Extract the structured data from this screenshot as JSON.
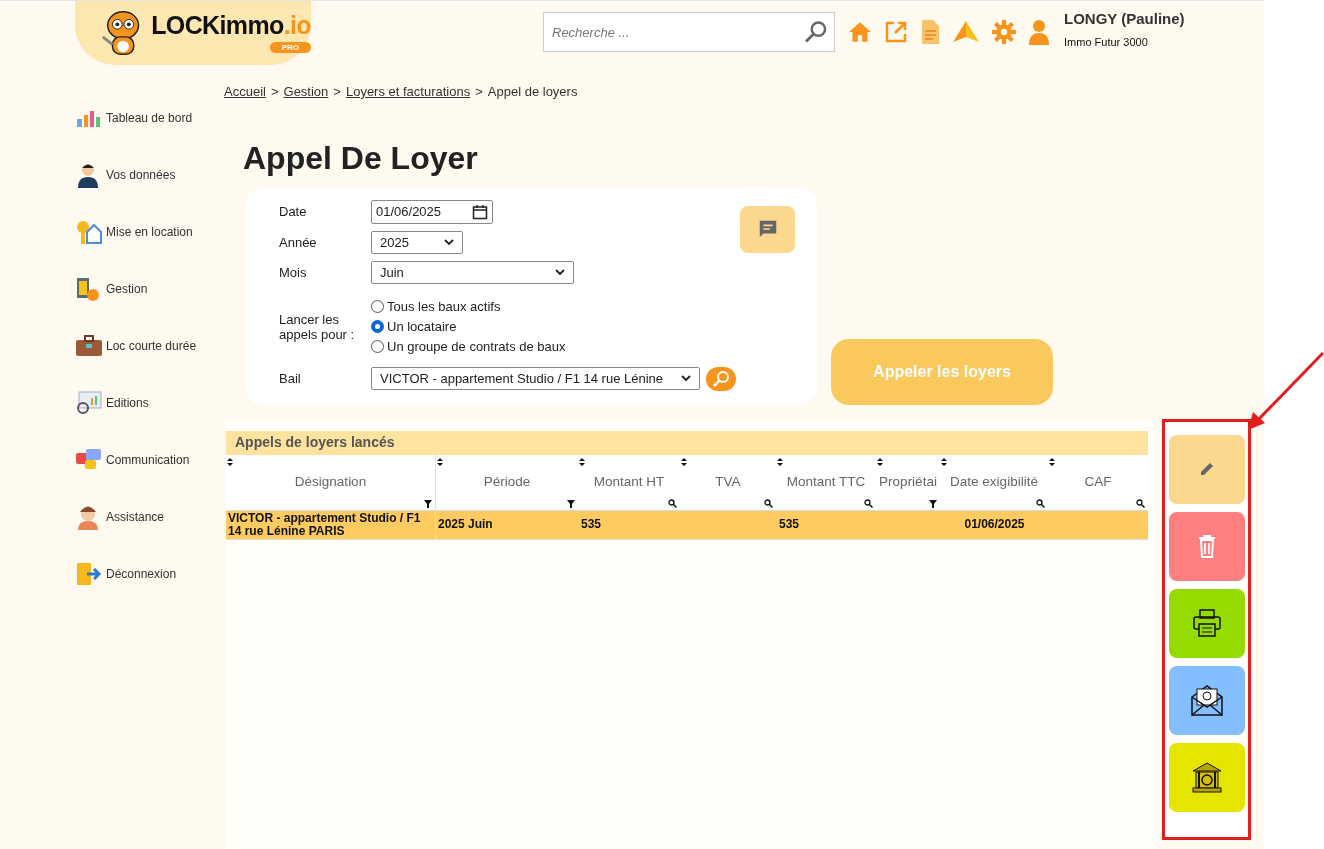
{
  "logo": {
    "name": "LOCKimmo",
    "suffix": ".io",
    "badge": "PRO"
  },
  "search": {
    "placeholder": "Recherche ..."
  },
  "user": {
    "name": "LONGY (Pauline)",
    "company": "Immo Futur 3000"
  },
  "sidebar": {
    "items": [
      {
        "label": "Tableau de bord",
        "kind": "chart"
      },
      {
        "label": "Vos données",
        "kind": "person"
      },
      {
        "label": "Mise en location",
        "kind": "key"
      },
      {
        "label": "Gestion",
        "kind": "calculator"
      },
      {
        "label": "Loc courte durée",
        "kind": "suitcase"
      },
      {
        "label": "Editions",
        "kind": "monitor"
      },
      {
        "label": "Communication",
        "kind": "chat"
      },
      {
        "label": "Assistance",
        "kind": "headset"
      },
      {
        "label": "Déconnexion",
        "kind": "exit"
      }
    ]
  },
  "breadcrumb": [
    {
      "label": "Accueil",
      "link": true
    },
    {
      "separator": ">",
      "label": "Gestion",
      "link": true
    },
    {
      "separator": ">",
      "label": "Loyers et facturations",
      "link": true
    },
    {
      "separator": ">",
      "label": "Appel de loyers",
      "link": false
    }
  ],
  "title": "Appel De Loyer",
  "form": {
    "date": {
      "label": "Date",
      "value": "01/06/2025"
    },
    "year": {
      "label": "Année",
      "value": "2025"
    },
    "month": {
      "label": "Mois",
      "value": "Juin"
    },
    "target": {
      "label": "Lancer les appels pour :",
      "options": [
        {
          "label": "Tous les baux actifs",
          "selected": false
        },
        {
          "label": "Un locataire",
          "selected": true
        },
        {
          "label": "Un groupe de contrats de baux",
          "selected": false
        }
      ]
    },
    "lease": {
      "label": "Bail",
      "value": "VICTOR - appartement Studio / F1 14 rue Lénine"
    }
  },
  "call_button": "Appeler les loyers",
  "table": {
    "title": "Appels de loyers lancés",
    "columns": [
      {
        "label": "Désignation",
        "kind": "list"
      },
      {
        "label": "Période",
        "kind": "list"
      },
      {
        "label": "Montant HT",
        "kind": "search"
      },
      {
        "label": "TVA",
        "kind": "search"
      },
      {
        "label": "Montant TTC",
        "kind": "search"
      },
      {
        "label": "Propriétai",
        "kind": "list"
      },
      {
        "label": "Date exigibilité",
        "kind": "search"
      },
      {
        "label": "CAF",
        "kind": "search"
      }
    ],
    "rows": [
      {
        "selected": true,
        "cells": [
          "VICTOR - appartement Studio / F1 14 rue Lénine PARIS",
          "2025 Juin",
          "535",
          "",
          "535",
          "",
          "01/06/2025",
          ""
        ]
      }
    ]
  },
  "actions": [
    {
      "kind": "edit"
    },
    {
      "kind": "delete"
    },
    {
      "kind": "print"
    },
    {
      "kind": "email"
    },
    {
      "kind": "bank"
    }
  ]
}
